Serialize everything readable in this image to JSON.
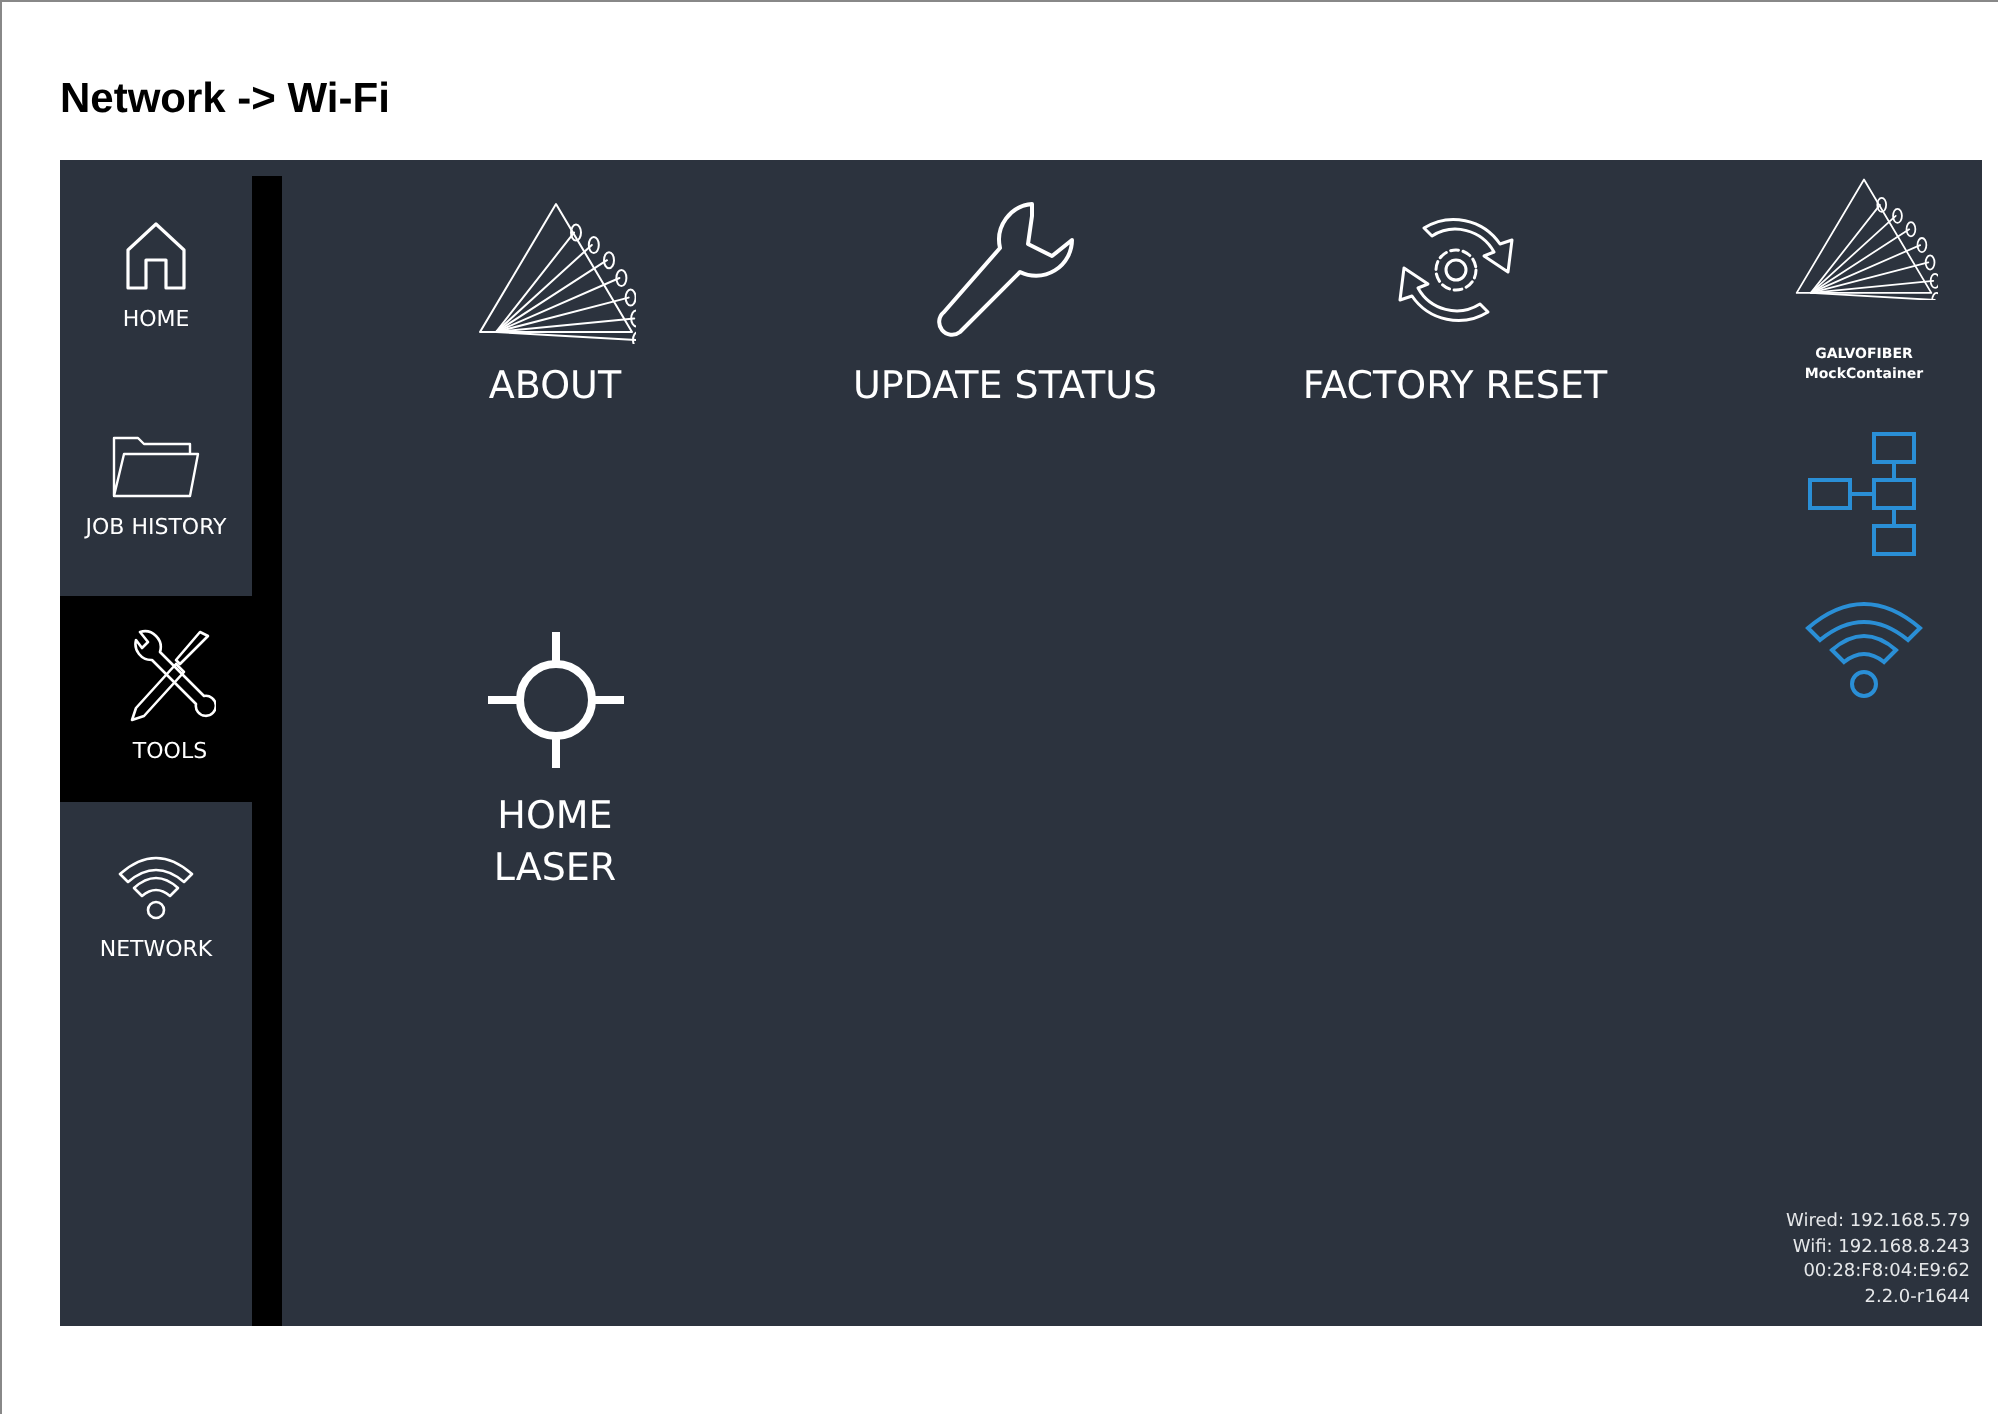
{
  "page_title": "Network -> Wi-Fi",
  "sidebar": {
    "items": [
      {
        "kind": "home",
        "label": "HOME",
        "selected": false
      },
      {
        "kind": "folder",
        "label": "JOB HISTORY",
        "selected": false
      },
      {
        "kind": "tools",
        "label": "TOOLS",
        "selected": true
      },
      {
        "kind": "wifi",
        "label": "NETWORK",
        "selected": false
      }
    ]
  },
  "tiles": [
    {
      "kind": "about",
      "label": "ABOUT"
    },
    {
      "kind": "wrench",
      "label": "UPDATE STATUS"
    },
    {
      "kind": "reset",
      "label": "FACTORY RESET"
    },
    {
      "kind": "crosshair",
      "label": "HOME LASER"
    }
  ],
  "brand": {
    "name": "GALVOFIBER",
    "container": "MockContainer"
  },
  "status_icons": [
    {
      "kind": "wired",
      "connected": true
    },
    {
      "kind": "wifi",
      "connected": true
    }
  ],
  "device_info": [
    "Wired: 192.168.5.79",
    "Wifi: 192.168.8.243",
    "00:28:F8:04:E9:62",
    "2.2.0-r1644"
  ]
}
